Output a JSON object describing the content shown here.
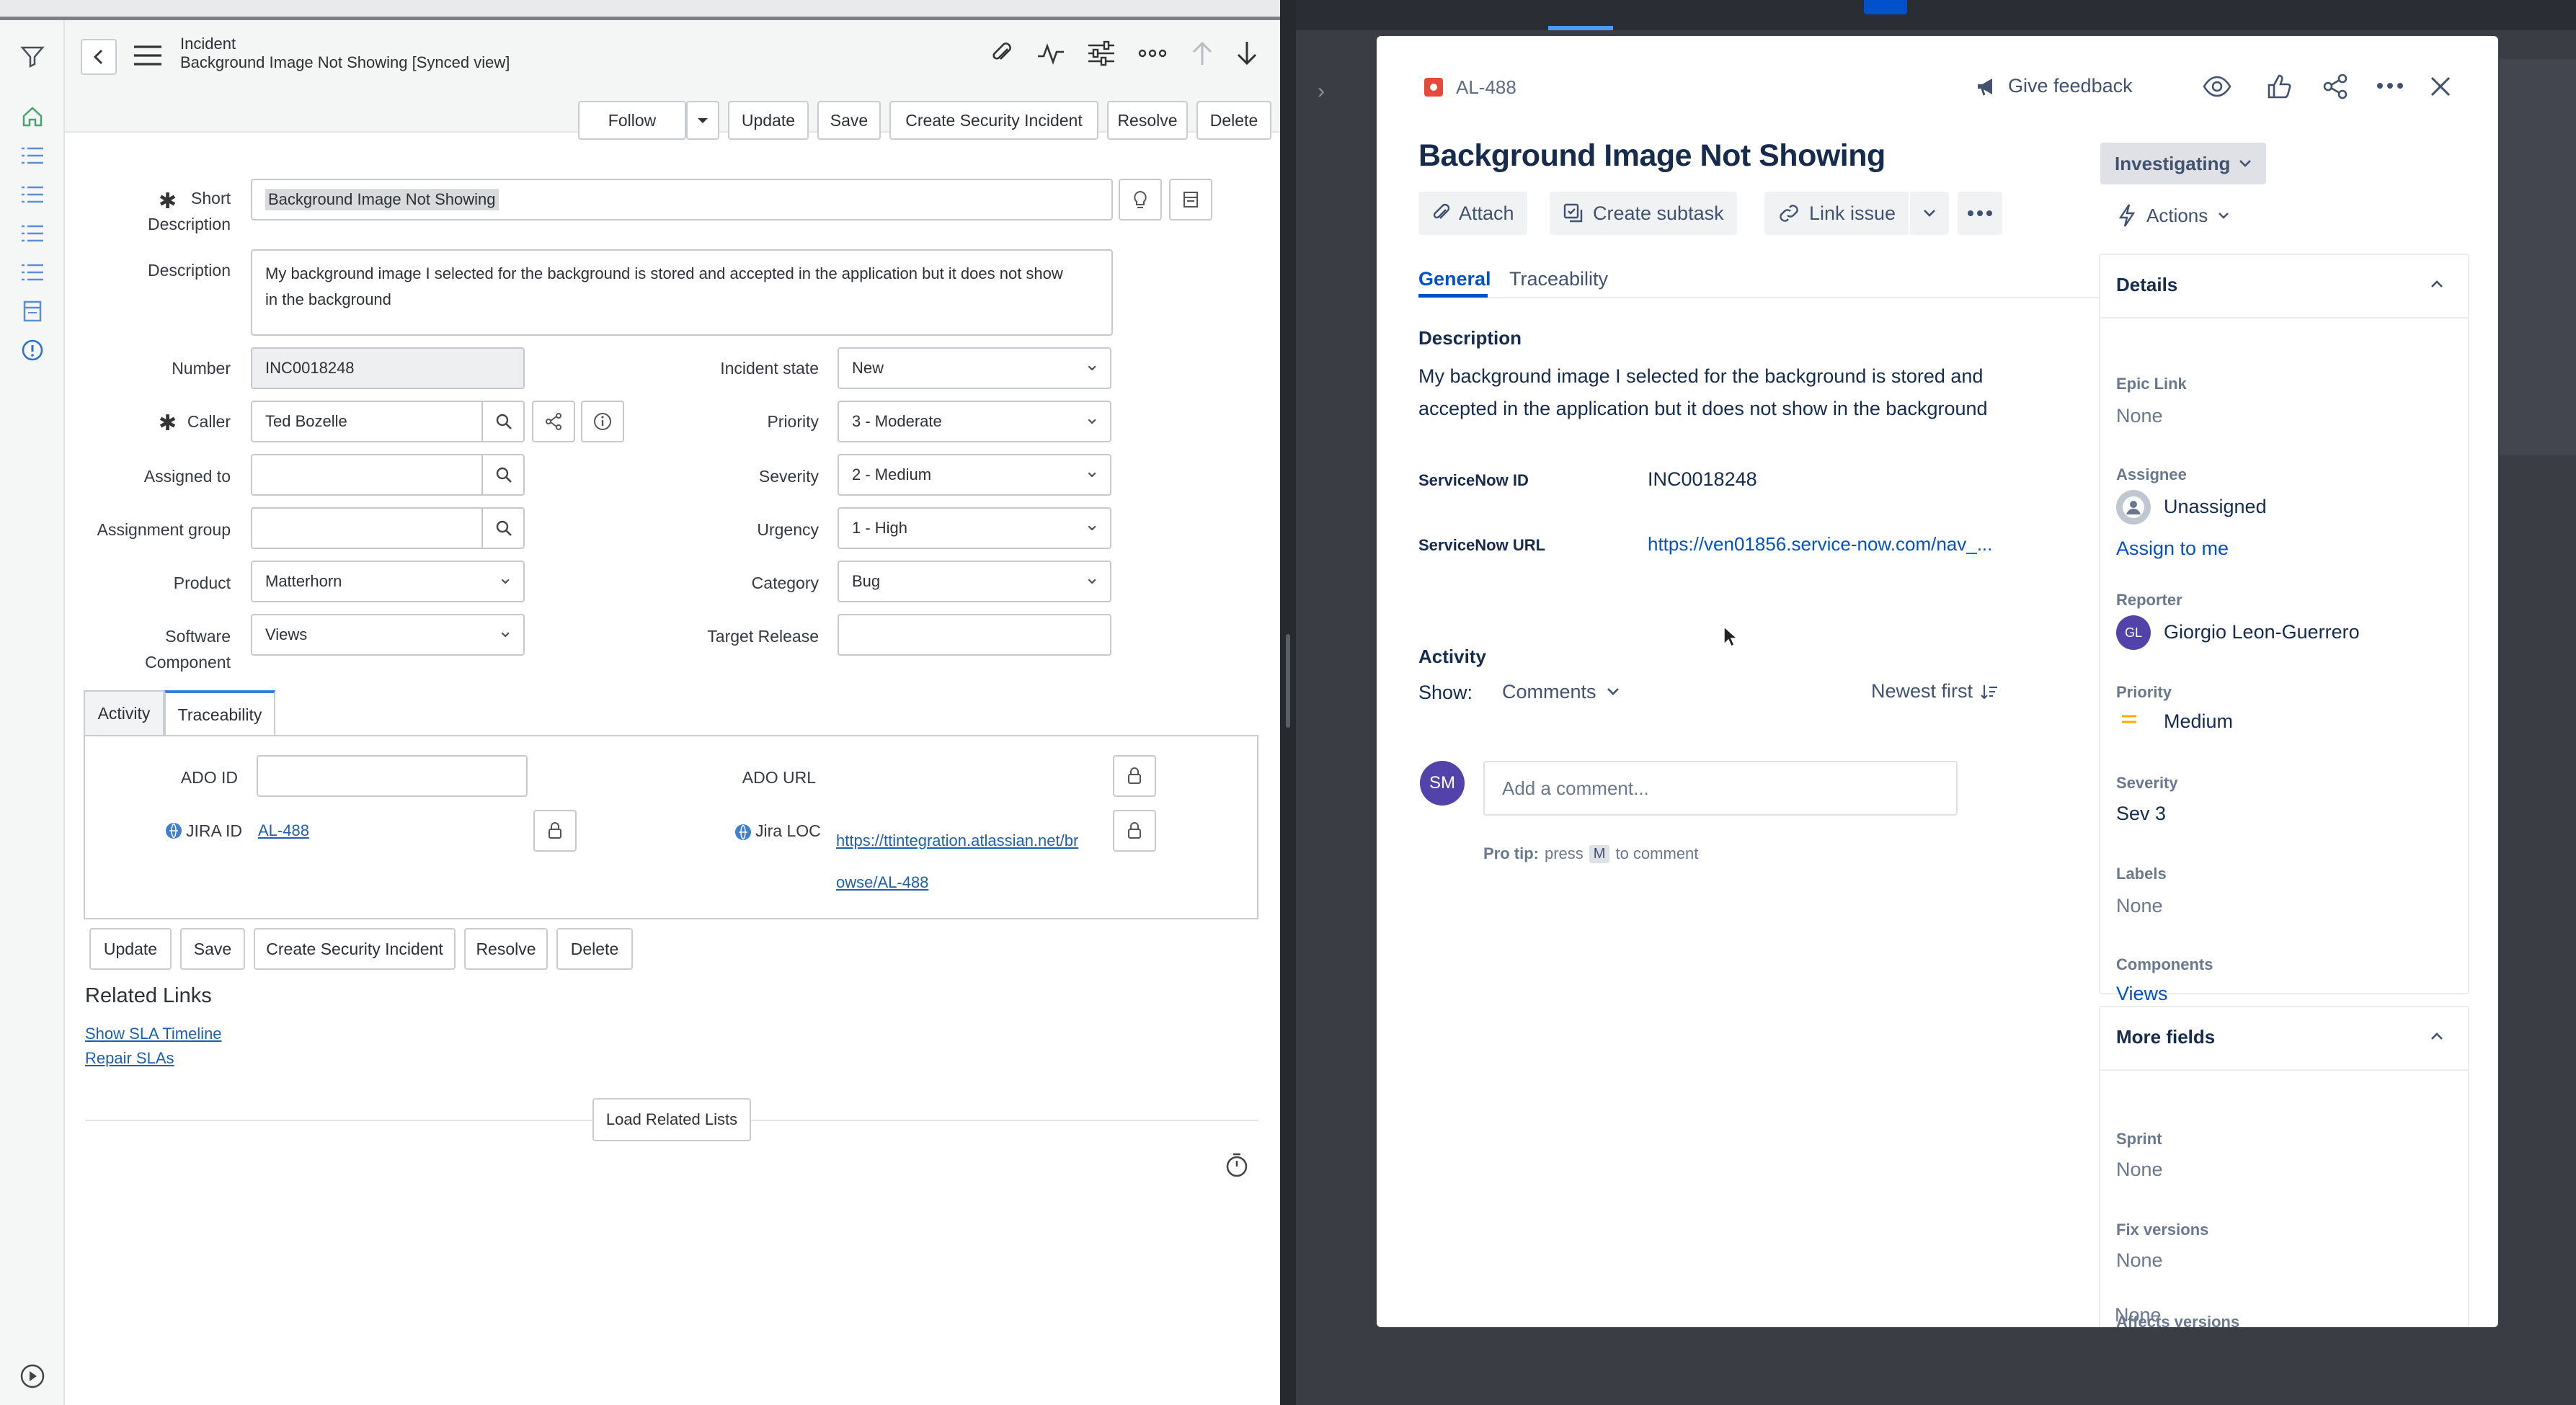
{
  "servicenow": {
    "header": {
      "type_label": "Incident",
      "title": "Background Image Not Showing [Synced view]"
    },
    "header_buttons": [
      "Follow",
      "Update",
      "Save",
      "Create Security Incident",
      "Resolve",
      "Delete"
    ],
    "form": {
      "short_description_label_1": "Short",
      "short_description_label_2": "Description",
      "short_description_value": "Background Image Not Showing",
      "description_label": "Description",
      "description_line1": "My background image I selected for the background is stored and accepted in the application but it does not show",
      "description_line2": "in the background",
      "number_label": "Number",
      "number_value": "INC0018248",
      "caller_label": "Caller",
      "caller_value": "Ted Bozelle",
      "assigned_to_label": "Assigned to",
      "assigned_to_value": "",
      "assignment_group_label": "Assignment group",
      "assignment_group_value": "",
      "product_label": "Product",
      "product_value": "Matterhorn",
      "software_component_label_1": "Software",
      "software_component_label_2": "Component",
      "software_component_value": "Views",
      "incident_state_label": "Incident state",
      "incident_state_value": "New",
      "priority_label": "Priority",
      "priority_value": "3 - Moderate",
      "severity_label": "Severity",
      "severity_value": "2 - Medium",
      "urgency_label": "Urgency",
      "urgency_value": "1 - High",
      "category_label": "Category",
      "category_value": "Bug",
      "target_release_label": "Target Release",
      "target_release_value": ""
    },
    "tabs": [
      "Activity",
      "Traceability"
    ],
    "traceability": {
      "ado_id_label": "ADO ID",
      "ado_url_label": "ADO URL",
      "jira_id_label": "JIRA ID",
      "jira_id_value": "AL-488",
      "jira_loc_label": "Jira LOC",
      "jira_loc_line1": "https://ttintegration.atlassian.net/br",
      "jira_loc_line2": "owse/AL-488"
    },
    "bottom_buttons": [
      "Update",
      "Save",
      "Create Security Incident",
      "Resolve",
      "Delete"
    ],
    "related_links": {
      "heading": "Related Links",
      "links": [
        "Show SLA Timeline",
        "Repair SLAs"
      ]
    },
    "load_related": "Load Related Lists"
  },
  "jira": {
    "issue_key": "AL-488",
    "give_feedback": "Give feedback",
    "title": "Background Image Not Showing",
    "status": "Investigating",
    "actions_label": "Actions",
    "toolbar": {
      "attach": "Attach",
      "create_subtask": "Create subtask",
      "link_issue": "Link issue"
    },
    "tabs": [
      "General",
      "Traceability"
    ],
    "description_heading": "Description",
    "description_line1": "My background image I selected for the background is stored and",
    "description_line2": "accepted in the application but it does not show in the background",
    "servicenow_id_label": "ServiceNow ID",
    "servicenow_id_value": "INC0018248",
    "servicenow_url_label": "ServiceNow URL",
    "servicenow_url_value": "https://ven01856.service-now.com/nav_...",
    "activity": {
      "heading": "Activity",
      "show_label": "Show:",
      "filter": "Comments",
      "sort": "Newest first",
      "avatar_initials": "SM",
      "comment_placeholder": "Add a comment...",
      "pro_tip_prefix": "Pro tip:",
      "pro_tip_press": "press",
      "pro_tip_key": "M",
      "pro_tip_suffix": "to comment"
    },
    "details": {
      "heading": "Details",
      "epic_link_label": "Epic Link",
      "epic_link_value": "None",
      "assignee_label": "Assignee",
      "assignee_value": "Unassigned",
      "assign_to_me": "Assign to me",
      "reporter_label": "Reporter",
      "reporter_initials": "GL",
      "reporter_value": "Giorgio Leon-Guerrero",
      "priority_label": "Priority",
      "priority_value": "Medium",
      "severity_label": "Severity",
      "severity_value": "Sev 3",
      "labels_label": "Labels",
      "labels_value": "None",
      "components_label": "Components",
      "components_value": "Views"
    },
    "more_fields": {
      "heading": "More fields",
      "sprint_label": "Sprint",
      "sprint_value": "None",
      "fix_versions_label": "Fix versions",
      "fix_versions_value": "None",
      "affects_versions_label": "Affects versions",
      "affects_versions_value": "None"
    },
    "colors": {
      "link": "#0052cc",
      "status_bg": "#dfe1e6",
      "avatar_sm": "#5243aa",
      "priority_medium": "#ffab00"
    }
  }
}
